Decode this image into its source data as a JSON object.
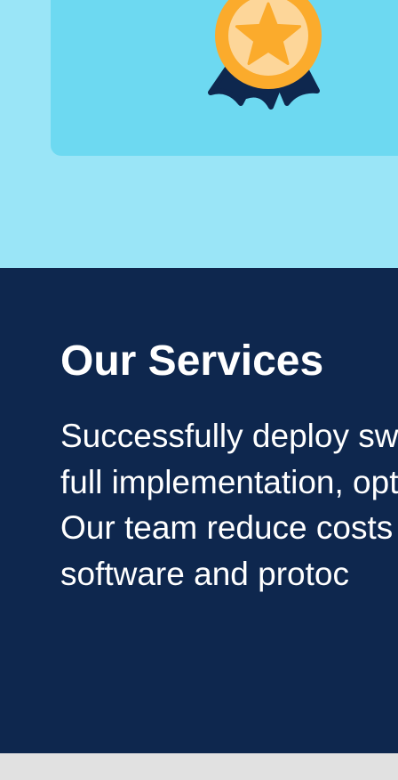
{
  "hero": {
    "icon": "award-medal-icon",
    "colors": {
      "background": "#9ae5f7",
      "card": "#6dd9f1",
      "medal_outer": "#fbab2c",
      "medal_inner": "#fdd699",
      "ribbon": "#0e274e"
    }
  },
  "services": {
    "title": "Our Services",
    "description": "Successfully deploy switches with a full implementation, opt services. Our team reduce costs and m software and protoc",
    "colors": {
      "background": "#0e274e",
      "text": "#ffffff"
    }
  }
}
